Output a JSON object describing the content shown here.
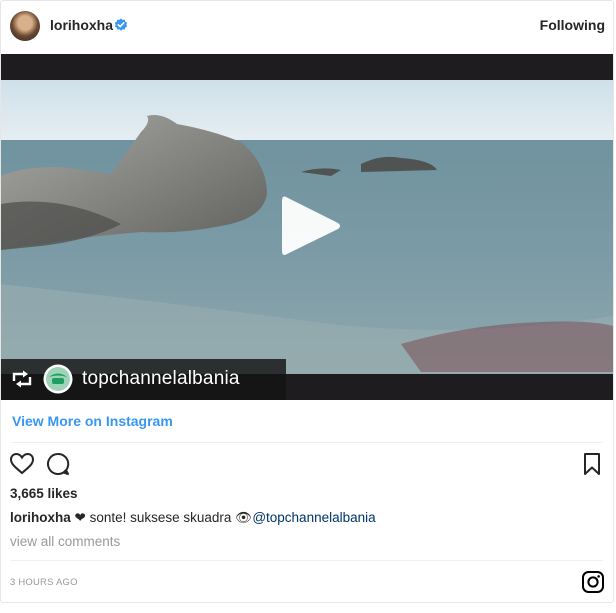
{
  "header": {
    "username": "lorihoxha",
    "follow_label": "Following"
  },
  "media": {
    "reposted_account": "topchannelalbania"
  },
  "view_more_label": "View More on Instagram",
  "likes_label": "3,665 likes",
  "caption": {
    "user": "lorihoxha",
    "heart": "❤",
    "text": " sonte! suksese skuadra ",
    "emoji": "👁",
    "mention": "@topchannelalbania"
  },
  "comments_link": "view all comments",
  "timestamp": "3 HOURS AGO",
  "colors": {
    "link": "#3897f0",
    "text": "#262626",
    "muted": "#999999",
    "verified": "#3897f0",
    "mention": "#003569"
  },
  "icons": [
    "verified-badge-icon",
    "play-icon",
    "repost-icon",
    "heart-icon",
    "comment-icon",
    "bookmark-icon",
    "instagram-glyph-icon"
  ]
}
